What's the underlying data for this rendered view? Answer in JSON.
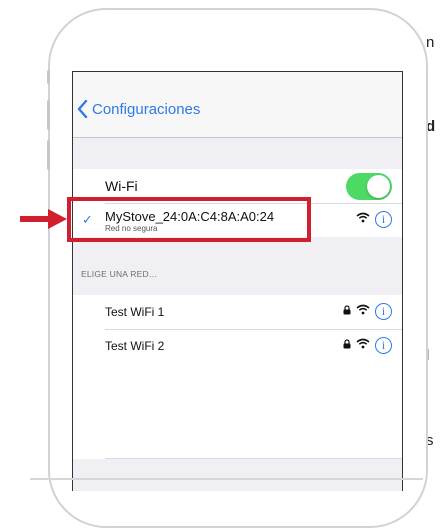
{
  "margin_text": [
    "n",
    "d",
    "l",
    "s"
  ],
  "nav": {
    "back_label": "Configuraciones"
  },
  "wifi": {
    "label": "Wi-Fi",
    "enabled": true
  },
  "connected": {
    "name": "MyStove_24:0A:C4:8A:A0:24",
    "status": "Red no segura",
    "check": "✓"
  },
  "section_header": "ELIGE UNA RED…",
  "networks": [
    {
      "name": "Test WiFi 1"
    },
    {
      "name": "Test WiFi 2"
    }
  ],
  "icons": {
    "info_glyph": "i"
  },
  "colors": {
    "accent": "#2f7ae5",
    "toggle_on": "#4cd964",
    "highlight": "#d11f2d"
  }
}
